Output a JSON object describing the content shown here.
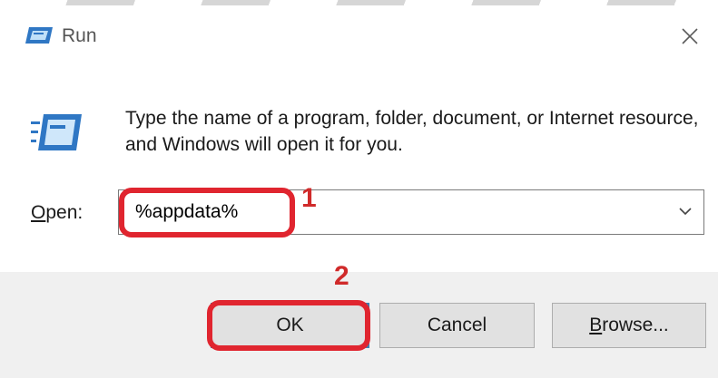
{
  "window": {
    "title": "Run",
    "icon": "run-app-icon",
    "close_icon": "close-icon"
  },
  "dialog": {
    "description": "Type the name of a program, folder, document, or Internet resource, and Windows will open it for you.",
    "open_label_underlined": "O",
    "open_label_rest": "pen:",
    "input_value": "%appdata%",
    "dropdown_icon": "chevron-down-icon"
  },
  "buttons": {
    "ok": "OK",
    "cancel": "Cancel",
    "browse_underlined": "B",
    "browse_rest": "rowse..."
  },
  "annotations": {
    "step1": "1",
    "step2": "2",
    "highlight_color": "#e0252f"
  }
}
